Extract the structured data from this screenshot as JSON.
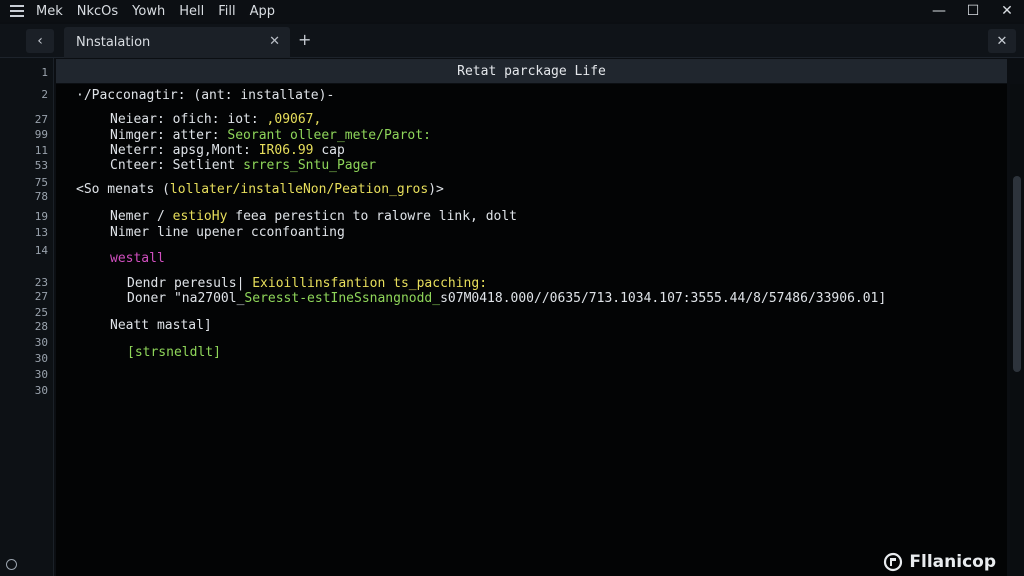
{
  "menubar": {
    "items": [
      "Mek",
      "NkcOs",
      "Yowh",
      "Hell",
      "Fill",
      "App"
    ]
  },
  "window_controls": {
    "minimize": "—",
    "maximize": "☐",
    "close": "✕"
  },
  "tabbar": {
    "back": "‹",
    "tab_label": "Nnstalation",
    "tab_close": "✕",
    "add": "+",
    "panel_close": "✕"
  },
  "editor": {
    "title": "Retat parckage Life"
  },
  "gutter_numbers": [
    "1",
    "2",
    "27",
    "99",
    "11",
    "53",
    "75",
    "78",
    "19",
    "13",
    "14",
    "23",
    "27",
    "25",
    "28",
    "30",
    "30",
    "30",
    "30"
  ],
  "code_lines": [
    [
      {
        "t": "·/Pacconagtir: (ant: installate)-",
        "c": "white"
      }
    ],
    [
      {
        "t": "Neiear: ofich: iot: ",
        "c": "white"
      },
      {
        "t": ",09067,",
        "c": "yellow"
      }
    ],
    [
      {
        "t": "Nimger: atter: ",
        "c": "white"
      },
      {
        "t": "Seorant olleer_mete/Parot:",
        "c": "green"
      }
    ],
    [
      {
        "t": "Neterr: apsg,Mont: ",
        "c": "white"
      },
      {
        "t": "IR06.99",
        "c": "yellow"
      },
      {
        "t": " cap",
        "c": "white"
      }
    ],
    [
      {
        "t": "Cnteer: Setlient ",
        "c": "white"
      },
      {
        "t": "srrers_Sntu_Pager",
        "c": "green"
      }
    ],
    [
      {
        "t": "<So menats (",
        "c": "white"
      },
      {
        "t": "lollater/installeNon/Peation_gros",
        "c": "yellow"
      },
      {
        "t": ")>",
        "c": "white"
      }
    ],
    [
      {
        "t": "Nemer / ",
        "c": "white"
      },
      {
        "t": "estioHy",
        "c": "yellow"
      },
      {
        "t": " feea peresticn to ralowre link, dolt",
        "c": "white"
      }
    ],
    [
      {
        "t": "Nimer line upener cconfoanting",
        "c": "white"
      }
    ],
    [
      {
        "t": "westall",
        "c": "magenta"
      }
    ],
    [
      {
        "t": "Dendr peresuls| ",
        "c": "white"
      },
      {
        "t": "Exioillinsfantion ts_pacching:",
        "c": "yellow"
      }
    ],
    [
      {
        "t": "Doner ",
        "c": "white"
      },
      {
        "t": "\"na2700l_",
        "c": "white"
      },
      {
        "t": "Seresst-estIneSsnangnodd_",
        "c": "green"
      },
      {
        "t": "s07M0418.000//0635/713.1034.107:3555.44/8/57486/33906.01]",
        "c": "white"
      }
    ],
    [
      {
        "t": "Neatt mastal]",
        "c": "white"
      }
    ],
    [
      {
        "t": "[strsneldlt]",
        "c": "green"
      }
    ]
  ],
  "brand": {
    "name": "Fllanicop"
  }
}
